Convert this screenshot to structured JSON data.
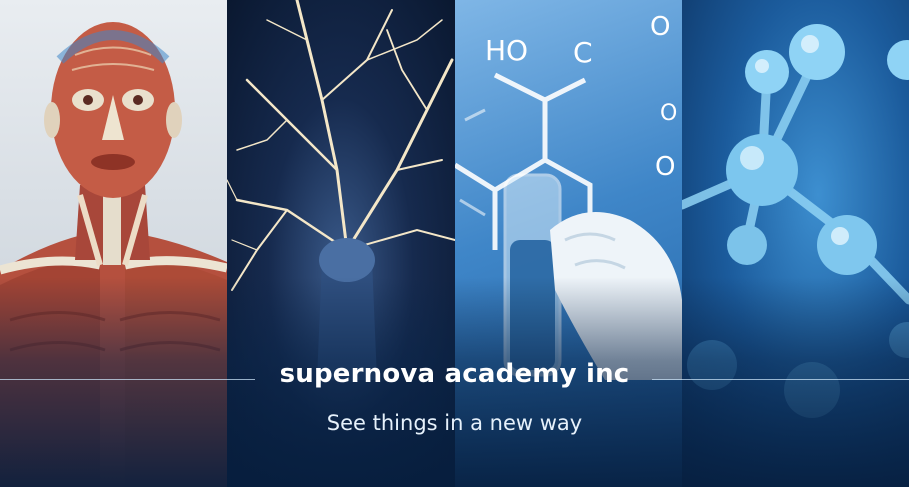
{
  "banner": {
    "title": "supernova academy inc",
    "tagline": "See things in a new way",
    "chem_labels": [
      "HO",
      "C",
      "O",
      "O",
      "O"
    ]
  },
  "colors": {
    "muscle": "#b5503e",
    "tendon": "#e7e0cf",
    "neuron": "#f4e7c8",
    "molecule": "#8fd3f5",
    "text": "#ffffff"
  }
}
